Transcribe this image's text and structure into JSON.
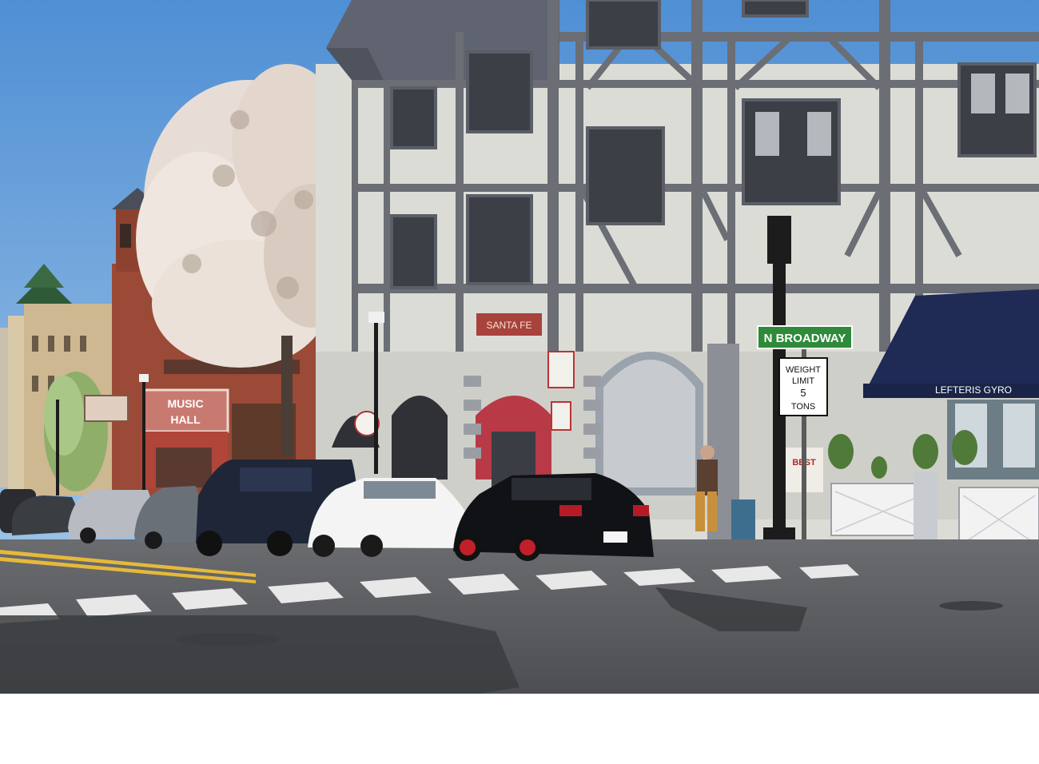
{
  "signs": {
    "street": "N BROADWAY",
    "weight_line1": "WEIGHT",
    "weight_line2": "LIMIT",
    "weight_line3": "5",
    "weight_line4": "TONS",
    "music_hall_1": "MUSIC",
    "music_hall_2": "HALL",
    "santa_fe": "SANTA FE",
    "lefteris": "LEFTERIS GYRO",
    "best": "BEST"
  },
  "colors": {
    "sky": "#5f9ad6",
    "stucco": "#dcdcd6",
    "timber": "#6b6e74",
    "brick": "#9a4a36",
    "awning": "#1f2a55",
    "street_sign": "#2f8a3a",
    "road": "#5b5d61"
  }
}
